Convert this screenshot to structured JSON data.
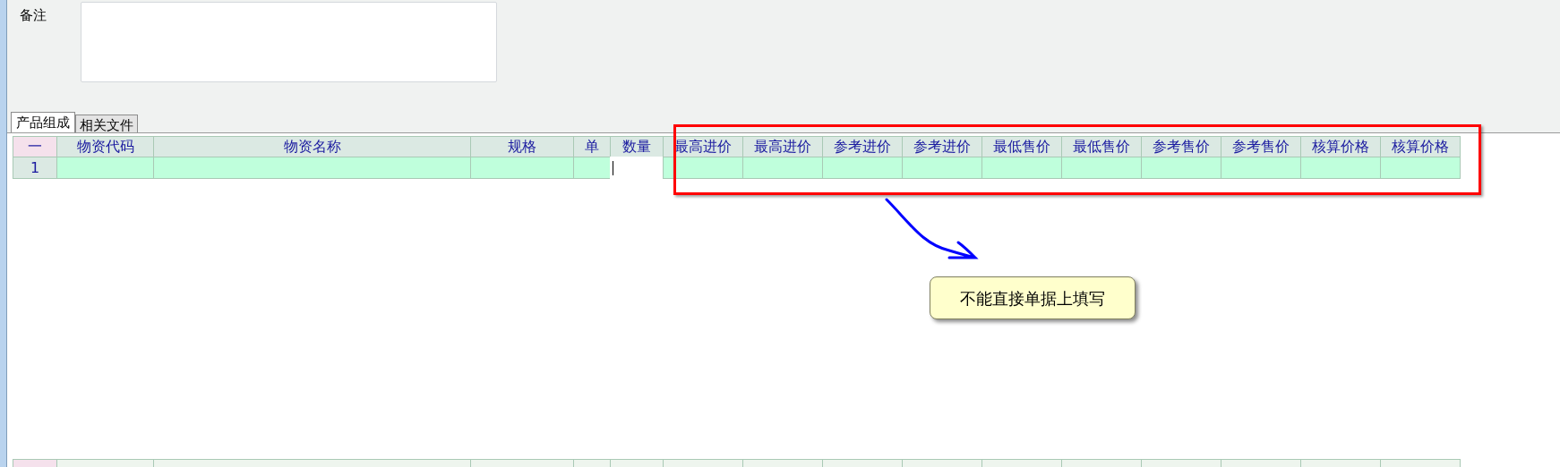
{
  "remark_field": {
    "label": "备注"
  },
  "tabs": [
    {
      "label": "产品组成",
      "selected": true
    },
    {
      "label": "相关文件",
      "selected": false
    }
  ],
  "grid": {
    "columns": [
      "一",
      "物资代码",
      "物资名称",
      "规格",
      "单",
      "数量",
      "最高进价",
      "最高进价",
      "参考进价",
      "参考进价",
      "最低售价",
      "最低售价",
      "参考售价",
      "参考售价",
      "核算价格",
      "核算价格"
    ],
    "rows": [
      {
        "number": "1",
        "cells": [
          {
            "focused": false
          },
          {
            "focused": false
          },
          {
            "focused": false
          },
          {
            "focused": false
          },
          {
            "focused": true
          },
          {
            "focused": false
          },
          {
            "focused": false
          },
          {
            "focused": false
          },
          {
            "focused": false
          },
          {
            "focused": false
          },
          {
            "focused": false
          },
          {
            "focused": false
          },
          {
            "focused": false
          },
          {
            "focused": false
          },
          {
            "focused": false
          }
        ]
      }
    ]
  },
  "callout": {
    "text": "不能直接单据上填写"
  }
}
